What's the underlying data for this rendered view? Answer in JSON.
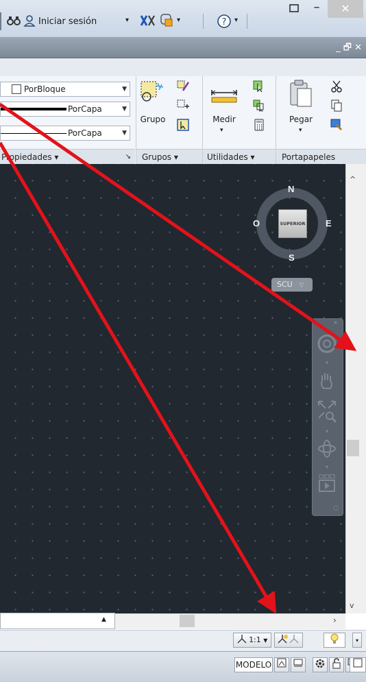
{
  "titlebar": {
    "signin_label": "Iniciar sesión",
    "help_icon": "question-icon"
  },
  "ribbon": {
    "properties": {
      "color_value": "PorBloque",
      "linetype_value": "PorCapa",
      "lineweight_value": "PorCapa",
      "panel_title": "Propiedades ▾"
    },
    "groups": {
      "group_label": "Grupo",
      "panel_title": "Grupos ▾"
    },
    "utilities": {
      "measure_label": "Medir",
      "panel_title": "Utilidades ▾"
    },
    "clipboard": {
      "paste_label": "Pegar",
      "panel_title": "Portapapeles"
    }
  },
  "viewcube": {
    "face_label": "SUPERIOR",
    "north": "N",
    "south": "S",
    "east": "E",
    "west": "O",
    "ucs_label": "SCU"
  },
  "annotation": {
    "scale_label": "1:1"
  },
  "statusbar": {
    "model_label": "MODELO"
  },
  "colors": {
    "viewport_bg": "#212830",
    "arrow": "#e3121a"
  }
}
